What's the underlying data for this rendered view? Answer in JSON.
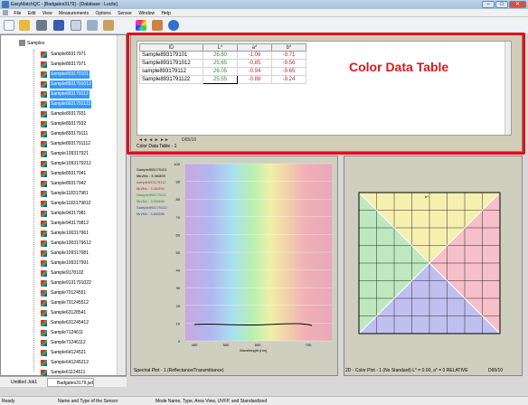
{
  "window": {
    "title": "EasyMatchQC - [Badgates3179] - [Database : Lucite]",
    "min": "–",
    "max": "□",
    "close": "✕"
  },
  "menu": [
    "File",
    "Edit",
    "View",
    "Measurements",
    "Options",
    "Sensor",
    "Window",
    "Help"
  ],
  "toolbar_icons": [
    "new-file-icon",
    "open-folder-icon",
    "printer-icon",
    "save-disk-icon",
    "print-preview-icon",
    "report-icon",
    "standardize-icon",
    "color-wheel-icon",
    "sensor-icon",
    "help-icon"
  ],
  "tree": {
    "root_label": "Samples",
    "items": [
      {
        "label": "Sample89317971",
        "selected": false
      },
      {
        "label": "Sample89317971",
        "selected": false
      },
      {
        "label": "Sample893179101",
        "selected": true
      },
      {
        "label": "Sample8931791012",
        "selected": true
      },
      {
        "label": "Sample893179112",
        "selected": true
      },
      {
        "label": "Sample8931791122",
        "selected": true
      },
      {
        "label": "Sample89317931",
        "selected": false
      },
      {
        "label": "Sample89317932",
        "selected": false
      },
      {
        "label": "Sample893179111",
        "selected": false
      },
      {
        "label": "Sample8931791112",
        "selected": false
      },
      {
        "label": "Sample109317921",
        "selected": false
      },
      {
        "label": "Sample1093179212",
        "selected": false
      },
      {
        "label": "Sample89317941",
        "selected": false
      },
      {
        "label": "Sample89317942",
        "selected": false
      },
      {
        "label": "Sample118317981",
        "selected": false
      },
      {
        "label": "Sample1183179812",
        "selected": false
      },
      {
        "label": "Sample94317981",
        "selected": false
      },
      {
        "label": "Sample943179812",
        "selected": false
      },
      {
        "label": "Sample100317961",
        "selected": false
      },
      {
        "label": "Sample1003179612",
        "selected": false
      },
      {
        "label": "Sample109317981",
        "selected": false
      },
      {
        "label": "Sample109317991",
        "selected": false
      },
      {
        "label": "Sample9178102",
        "selected": false
      },
      {
        "label": "Sample9131791022",
        "selected": false
      },
      {
        "label": "Sample70124551",
        "selected": false
      },
      {
        "label": "Sample701245512",
        "selected": false
      },
      {
        "label": "Sample63128541",
        "selected": false
      },
      {
        "label": "Sample631245412",
        "selected": false
      },
      {
        "label": "Sample7124611",
        "selected": false
      },
      {
        "label": "Sample71246112",
        "selected": false
      },
      {
        "label": "Sample64124521",
        "selected": false
      },
      {
        "label": "Sample641245212",
        "selected": false
      },
      {
        "label": "Sample61124511",
        "selected": false
      }
    ]
  },
  "bottom_tabs": [
    "Untitled Job1",
    "Badgates3179.jsd"
  ],
  "color_table": {
    "headers": [
      "ID",
      "L*",
      "a*",
      "b*"
    ],
    "rows": [
      {
        "id": "Sample893179101",
        "L": "26.80",
        "a": "-1.06",
        "b": "-9.71"
      },
      {
        "id": "Sample8931791012",
        "L": "25.65",
        "a": "-0.85",
        "b": "-9.56"
      },
      {
        "id": "sample893179112",
        "L": "26.05",
        "a": "-0.94",
        "b": "-9.65"
      },
      {
        "id": "Sample8931791122",
        "L": "25.55",
        "a": "-0.88",
        "b": "-9.24"
      }
    ],
    "pager": "D65/10",
    "panel_title": "Color Data Table - 1"
  },
  "overlay_label": "Color Data Table",
  "spectral": {
    "title": "Spectral Plot - 1 (Reflectance/Transmittance)",
    "xlabel": "Wavelength (nm)",
    "ylabel": "",
    "yticks": [
      "100",
      "90",
      "80",
      "70",
      "60",
      "50",
      "40",
      "30",
      "20",
      "10",
      "0"
    ],
    "xticks": [
      "400",
      "500",
      "600",
      "700"
    ],
    "legend": [
      {
        "name": "Sample893179101",
        "color": "#000000"
      },
      {
        "name": "Min/Mx : 3.98/890",
        "color": "#000000"
      },
      {
        "name": "sample893179112",
        "color": "#b03030"
      },
      {
        "name": "Mn/Mx : 3.46/890",
        "color": "#b03030"
      },
      {
        "name": "Sample893179111",
        "color": "#2e8b2e"
      },
      {
        "name": "Mn/Mx : 3.59/890",
        "color": "#2e8b2e"
      },
      {
        "name": "Sample893179122",
        "color": "#2040b0"
      },
      {
        "name": "Mn/Mx : 3.84/890",
        "color": "#2040b0"
      }
    ]
  },
  "color2d": {
    "title": "2D - Color Plot - 1 (No Standard) L* = 0.00, a* = 0 RELATIVE",
    "illuminant": "D65/10",
    "top_label": "b*"
  },
  "status": {
    "ready": "Ready",
    "sensor": "Name and Type of the Sensor",
    "mode": "Mode Name, Type, Area View, UVFP, and Standardized"
  },
  "colors": {
    "accent_red": "#e0101a",
    "selection": "#3399ff"
  }
}
